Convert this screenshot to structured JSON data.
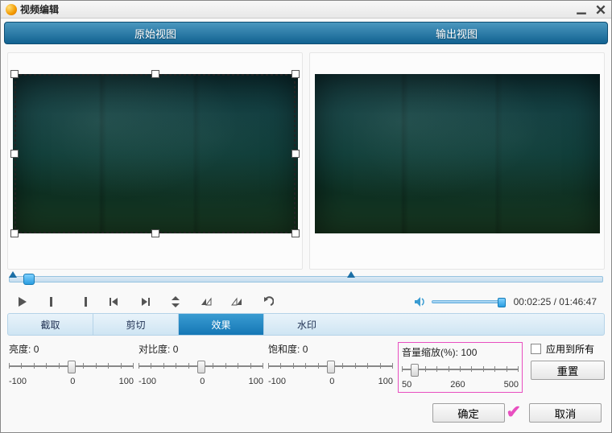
{
  "window": {
    "title": "视频编辑"
  },
  "header": {
    "original": "原始视图",
    "output": "输出视图"
  },
  "transport": {
    "time_display": "00:02:25 / 01:46:47"
  },
  "tabs": [
    {
      "id": "crop",
      "label": "截取",
      "active": false
    },
    {
      "id": "trim",
      "label": "剪切",
      "active": false
    },
    {
      "id": "effect",
      "label": "效果",
      "active": true
    },
    {
      "id": "watermark",
      "label": "水印",
      "active": false
    }
  ],
  "sliders": {
    "brightness": {
      "label": "亮度:",
      "value": "0",
      "min": "-100",
      "mid": "0",
      "max": "100",
      "pos": 50
    },
    "contrast": {
      "label": "对比度:",
      "value": "0",
      "min": "-100",
      "mid": "0",
      "max": "100",
      "pos": 50
    },
    "saturation": {
      "label": "饱和度:",
      "value": "0",
      "min": "-100",
      "mid": "0",
      "max": "100",
      "pos": 50
    },
    "volume": {
      "label": "音量缩放(%):",
      "value": "100",
      "min": "50",
      "mid": "260",
      "max": "500",
      "pos": 11
    }
  },
  "options": {
    "apply_all_label": "应用到所有",
    "reset_label": "重置"
  },
  "footer": {
    "ok_label": "确定",
    "cancel_label": "取消"
  }
}
